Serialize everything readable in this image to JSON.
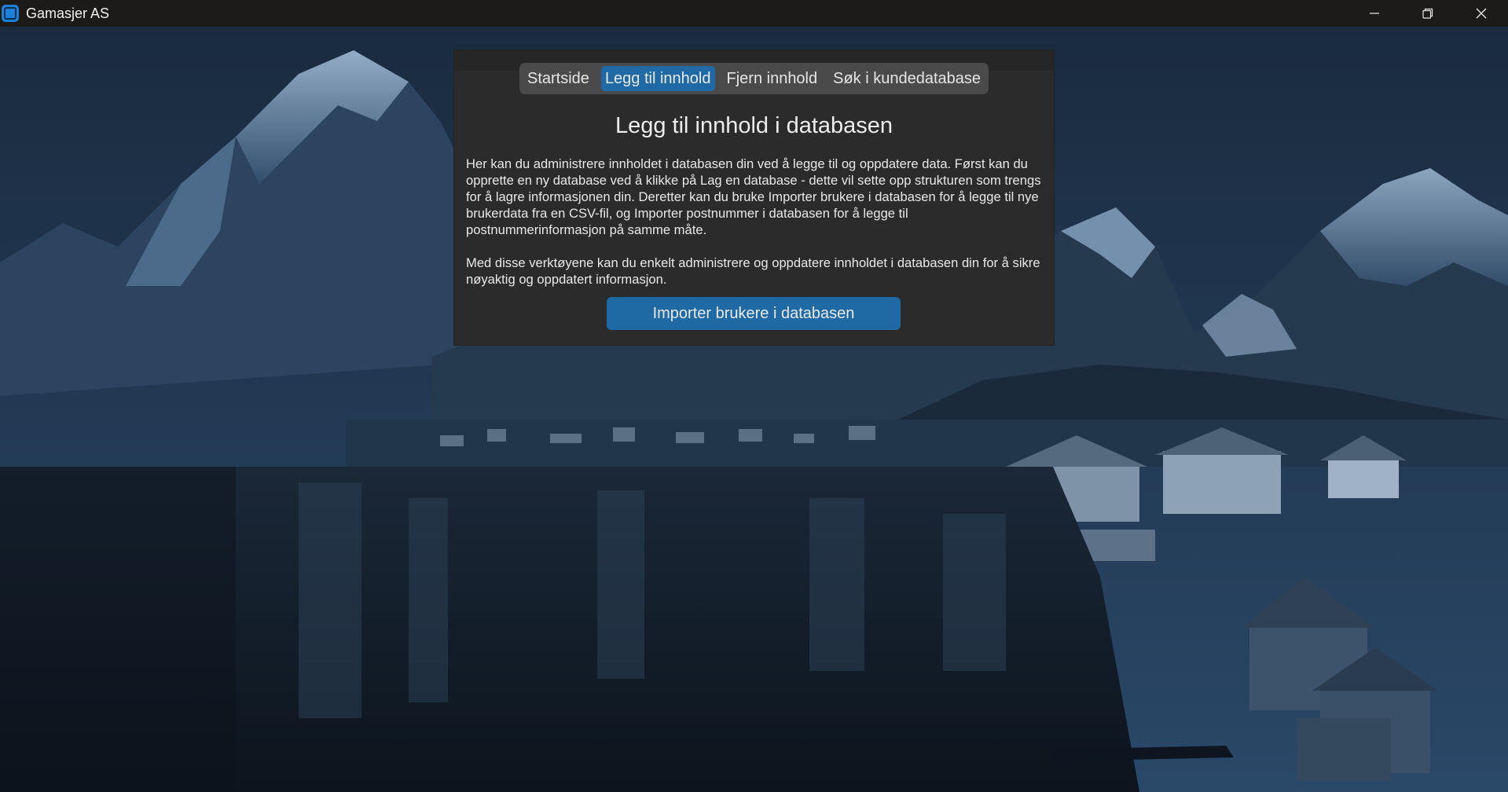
{
  "window": {
    "title": "Gamasjer AS",
    "controls": [
      "minimize-icon",
      "restore-icon",
      "close-icon"
    ]
  },
  "tabs": [
    {
      "label": "Startside",
      "active": false
    },
    {
      "label": "Legg til innhold",
      "active": true
    },
    {
      "label": "Fjern innhold",
      "active": false
    },
    {
      "label": "Søk i kundedatabase",
      "active": false
    }
  ],
  "main": {
    "heading": "Legg til innhold i databasen",
    "paragraph1": "Her kan du administrere innholdet i databasen din ved å legge til og oppdatere data. Først kan du opprette en ny database ved å klikke på Lag en database - dette vil sette opp strukturen som trengs for å lagre informasjonen din. Deretter kan du bruke Importer brukere i databasen for å legge til nye brukerdata fra en CSV-fil, og Importer postnummer i databasen for å legge til postnummerinformasjon på samme måte.",
    "paragraph2": "Med disse verktøyene kan du enkelt administrere og oppdatere innholdet i databasen din for å sikre nøyaktig og oppdatert informasjon.",
    "import_button": "Importer brukere i databasen"
  },
  "colors": {
    "accent": "#1f6aa5",
    "panel": "#2b2b2b",
    "tabbar": "#4a4a4a",
    "titlebar": "#1d1b1a"
  }
}
